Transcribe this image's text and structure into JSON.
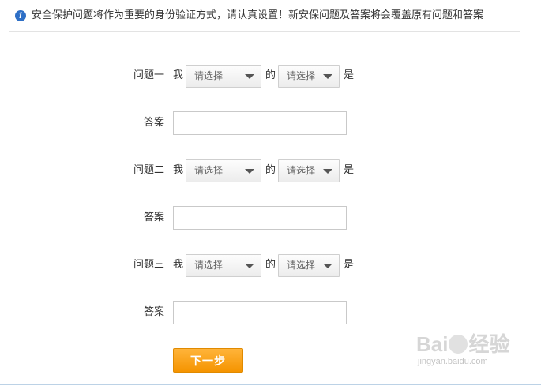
{
  "notice": {
    "icon": "info-icon",
    "text": "安全保护问题将作为重要的身份验证方式，请认真设置！新安保问题及答案将会覆盖原有问题和答案"
  },
  "connectors": {
    "wo": "我",
    "de": "的",
    "shi": "是"
  },
  "questions": [
    {
      "label": "问题一",
      "select_a": "请选择",
      "select_b": "请选择",
      "answer_label": "答案",
      "answer_value": ""
    },
    {
      "label": "问题二",
      "select_a": "请选择",
      "select_b": "请选择",
      "answer_label": "答案",
      "answer_value": ""
    },
    {
      "label": "问题三",
      "select_a": "请选择",
      "select_b": "请选择",
      "answer_label": "答案",
      "answer_value": ""
    }
  ],
  "next_button": {
    "label": "下一步"
  },
  "watermark": {
    "logo_left": "Bai",
    "logo_right": "经验",
    "url": "jingyan.baidu.com"
  },
  "colors": {
    "accent": "#f59400",
    "info_icon": "#2e6fc6"
  }
}
